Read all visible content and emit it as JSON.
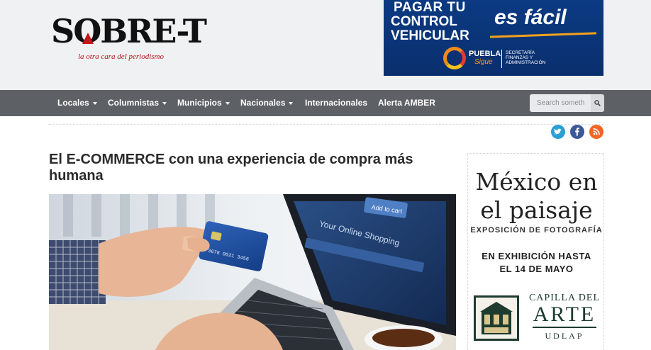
{
  "header": {
    "logo_main": "SOBRE-T",
    "logo_tagline": "la otra cara del periodismo"
  },
  "ad_top": {
    "line1": "PAGAR TU",
    "line2": "CONTROL",
    "line3": "VEHICULAR",
    "headline": "es fácil",
    "brand": "PUEBLA",
    "brand_sub": "Sigue",
    "secretaria_1": "SECRETARÍA",
    "secretaria_2": "FINANZAS Y",
    "secretaria_3": "ADMINISTRACIÓN",
    "colors": {
      "bg": "#0b3a82",
      "accent": "#f4a21b"
    }
  },
  "nav": {
    "items": [
      {
        "label": "Locales",
        "dropdown": true
      },
      {
        "label": "Columnistas",
        "dropdown": true
      },
      {
        "label": "Municipios",
        "dropdown": true
      },
      {
        "label": "Nacionales",
        "dropdown": true
      },
      {
        "label": "Internacionales",
        "dropdown": false
      },
      {
        "label": "Alerta AMBER",
        "dropdown": false
      }
    ],
    "search": {
      "placeholder": "Search someth",
      "icon": "search-icon"
    },
    "colors": {
      "bg": "#5d6166"
    }
  },
  "social": [
    {
      "name": "twitter-icon",
      "color": "#2a9fd6"
    },
    {
      "name": "facebook-icon",
      "color": "#3b5998"
    },
    {
      "name": "rss-icon",
      "color": "#f26522"
    }
  ],
  "article": {
    "title": "El E-COMMERCE con una experiencia de compra más humana",
    "image": {
      "screen_text": "Your Online Shopping",
      "button_text": "Add to cart",
      "card_number": "3678 0021 3456"
    }
  },
  "side_ad": {
    "heading_1": "México en",
    "heading_2": "el paisaje",
    "subheading": "EXPOSICIÓN DE FOTOGRAFÍA",
    "exhibit_1": "EN EXHIBICIÓN HASTA",
    "exhibit_2": "EL 14 DE MAYO",
    "venue_1": "CAPILLA DEL",
    "venue_2": "ARTE",
    "venue_3": "UDLAP"
  }
}
